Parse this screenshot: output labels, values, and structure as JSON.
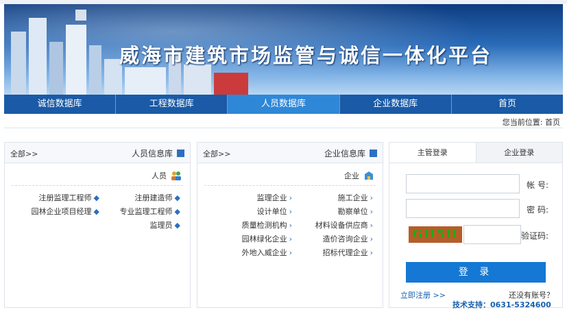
{
  "banner": {
    "title": "威海市建筑市场监管与诚信一体化平台"
  },
  "nav": {
    "items": [
      {
        "label": "诚信数据库"
      },
      {
        "label": "工程数据库"
      },
      {
        "label": "人员数据库",
        "active": true
      },
      {
        "label": "企业数据库"
      },
      {
        "label": "首页"
      }
    ]
  },
  "breadcrumb": {
    "text": "您当前位置: 首页"
  },
  "personnel_panel": {
    "title": "人员信息库",
    "more": "全部>>",
    "sub_title": "人员",
    "items": [
      "注册监理工程师",
      "注册建造师",
      "园林企业项目经理",
      "专业监理工程师",
      "",
      "监理员"
    ]
  },
  "enterprise_panel": {
    "title": "企业信息库",
    "more": "全部>>",
    "sub_title": "企业",
    "items": [
      "监理企业",
      "施工企业",
      "设计单位",
      "勘察单位",
      "质量检测机构",
      "材料设备供应商",
      "园林绿化企业",
      "造价咨询企业",
      "外地入威企业",
      "招标代理企业"
    ]
  },
  "login": {
    "tab_active": "主管登录",
    "tab_inactive": "企业登录",
    "account_label": "帐  号:",
    "password_label": "密  码:",
    "captcha_label": "验证码:",
    "captcha_text": "GH5H",
    "button": "登 录",
    "no_account": "还没有账号？",
    "register_link": "立即注册 >>",
    "support": "技术支持：0631-5324600"
  },
  "colors": {
    "nav_bg": "#1a5aa6",
    "nav_active": "#2f87d8",
    "login_button": "#1478d4"
  }
}
